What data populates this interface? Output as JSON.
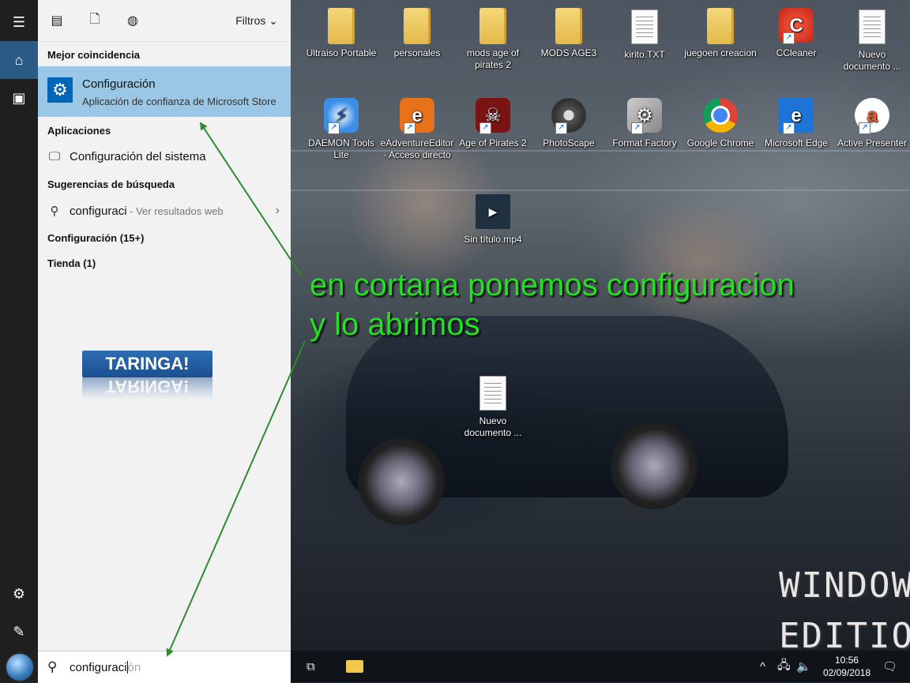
{
  "start_panel": {
    "filters_label": "Filtros",
    "best_match_header": "Mejor coincidencia",
    "best_match": {
      "title": "Configuración",
      "subtitle": "Aplicación de confianza de Microsoft Store",
      "icon": "gear-icon"
    },
    "apps_header": "Aplicaciones",
    "apps": [
      {
        "label": "Configuración del sistema",
        "icon": "monitor-icon"
      }
    ],
    "suggestions_header": "Sugerencias de búsqueda",
    "suggestion": {
      "query": "configuraci",
      "hint": " - Ver resultados web"
    },
    "settings_count": "Configuración (15+)",
    "store_count": "Tienda (1)",
    "taringa_logo": "TARINGA!"
  },
  "search": {
    "typed": "configuraci",
    "ghost": "ón"
  },
  "desktop_icons": [
    {
      "label": "Ultraiso Portable",
      "type": "folder"
    },
    {
      "label": "personales",
      "type": "folder"
    },
    {
      "label": "mods age of pirates 2",
      "type": "folder"
    },
    {
      "label": "MODS AGE3",
      "type": "folder"
    },
    {
      "label": "kirito.TXT",
      "type": "doc"
    },
    {
      "label": "juegoen creacion",
      "type": "folder"
    },
    {
      "label": "CCleaner",
      "type": "app"
    },
    {
      "label": "Nuevo documento ...",
      "type": "doc"
    },
    {
      "label": "DAEMON Tools Lite",
      "type": "app"
    },
    {
      "label": "eAdventureEditor - Acceso directo",
      "type": "app"
    },
    {
      "label": "Age of Pirates 2",
      "type": "app"
    },
    {
      "label": "PhotoScape",
      "type": "app"
    },
    {
      "label": "Format Factory",
      "type": "app"
    },
    {
      "label": "Google Chrome",
      "type": "app"
    },
    {
      "label": "Microsoft Edge",
      "type": "app"
    },
    {
      "label": "Active Presenter",
      "type": "app"
    },
    {
      "label": "Sin título.mp4",
      "type": "video"
    },
    {
      "label": "Nuevo documento ...",
      "type": "doc"
    }
  ],
  "wallpaper_text": {
    "line1": "WINDOWS",
    "line2": "EDITION LI"
  },
  "annotation": {
    "line1": "en cortana ponemos configuracion",
    "line2": "y lo abrimos"
  },
  "taskbar": {
    "time": "10:56",
    "date": "02/09/2018"
  },
  "colors": {
    "highlight": "#9bc7e6",
    "accent": "#0067b8",
    "annotation": "#22e022"
  }
}
